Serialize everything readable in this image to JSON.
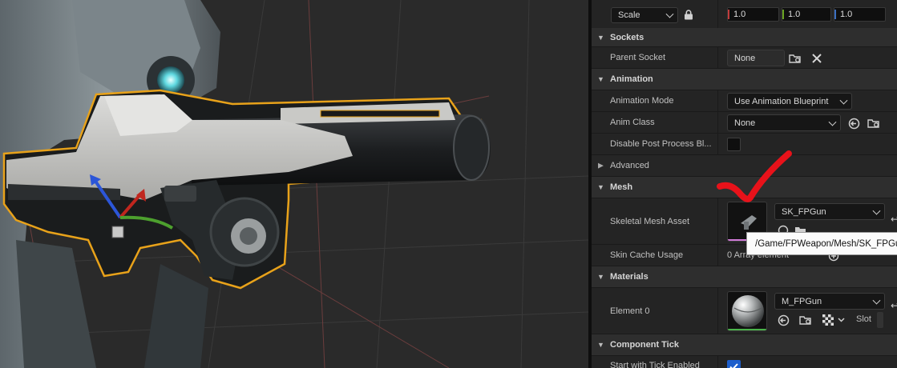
{
  "transform": {
    "scale_label": "Scale",
    "scale_x": "1.0",
    "scale_y": "1.0",
    "scale_z": "1.0",
    "axis_colors": {
      "x": "#c13b3b",
      "y": "#6aa521",
      "z": "#3b6fc1"
    }
  },
  "sockets": {
    "category": "Sockets",
    "parent_socket_label": "Parent Socket",
    "parent_socket_value": "None"
  },
  "animation": {
    "category": "Animation",
    "mode_label": "Animation Mode",
    "mode_value": "Use Animation Blueprint",
    "class_label": "Anim Class",
    "class_value": "None",
    "disable_post_label": "Disable Post Process Bl..."
  },
  "advanced": {
    "category": "Advanced"
  },
  "mesh": {
    "category": "Mesh",
    "skeletal_mesh_label": "Skeletal Mesh Asset",
    "skeletal_mesh_value": "SK_FPGun",
    "skin_cache_label": "Skin Cache Usage",
    "skin_cache_value": "0 Array element"
  },
  "materials": {
    "category": "Materials",
    "element0_label": "Element 0",
    "element0_value": "M_FPGun",
    "slot_label": "Slot"
  },
  "component_tick": {
    "category": "Component Tick",
    "start_tick_label": "Start with Tick Enabled"
  },
  "tooltip": {
    "text": "/Game/FPWeapon/Mesh/SK_FPGun"
  },
  "colors": {
    "selection_outline": "#e8a21a",
    "annotation_check": "#e8121a",
    "checkbox_on": "#1e5fcc"
  }
}
